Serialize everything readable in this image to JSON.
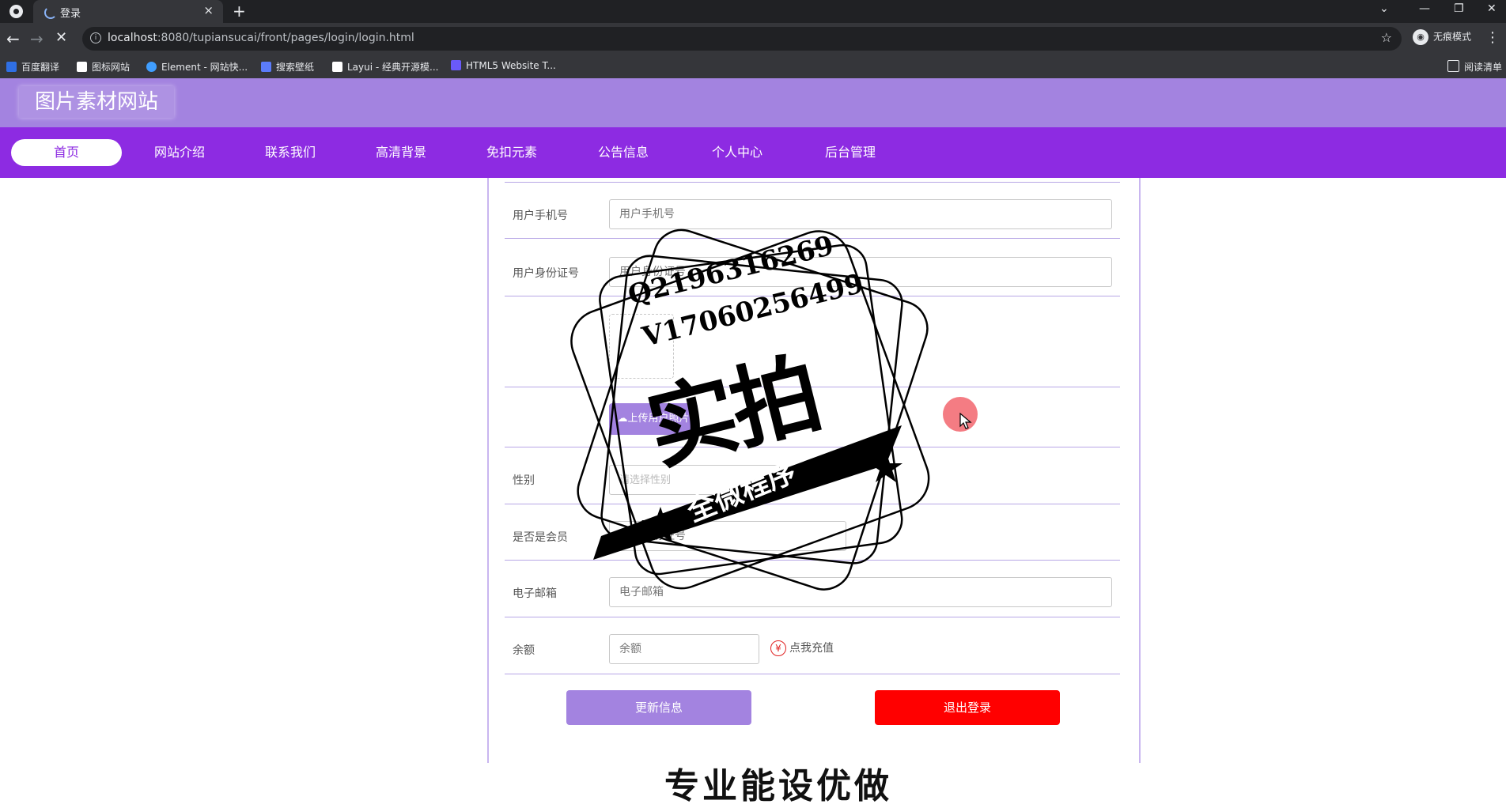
{
  "browser": {
    "tab_title": "登录",
    "tab_close": "×",
    "new_tab": "+",
    "url_host": "localhost",
    "url_path": ":8080/tupiansucai/front/pages/login/login.html",
    "incognito_label": "无痕模式",
    "reading_list": "阅读清单",
    "bookmarks": [
      {
        "label": "百度翻译",
        "color": "#2f6fe4"
      },
      {
        "label": "图标网站",
        "color": "#ffffff"
      },
      {
        "label": "Element - 网站快...",
        "color": "#409eff"
      },
      {
        "label": "搜索壁纸",
        "color": "#5b7cfa"
      },
      {
        "label": "Layui - 经典开源模...",
        "color": "#ffffff"
      },
      {
        "label": "HTML5 Website T...",
        "color": "#6a5af9"
      }
    ]
  },
  "site": {
    "logo": "图片素材网站",
    "nav": [
      "首页",
      "网站介绍",
      "联系我们",
      "高清背景",
      "免扣元素",
      "公告信息",
      "个人中心",
      "后台管理"
    ]
  },
  "form": {
    "phone_label": "用户手机号",
    "phone_placeholder": "用户手机号",
    "idcard_label": "用户身份证号",
    "idcard_placeholder": "用户身份证号",
    "upload_button": "上传用户照片",
    "gender_label": "性别",
    "gender_placeholder": "请选择性别",
    "member_label": "是否是会员",
    "member_placeholder": "用户身份证号",
    "email_label": "电子邮箱",
    "email_placeholder": "电子邮箱",
    "balance_label": "余额",
    "balance_placeholder": "余额",
    "recharge_icon": "¥",
    "recharge_link": "点我充值",
    "update_button": "更新信息",
    "logout_button": "退出登录"
  },
  "bottom_heading": "专业能设优做",
  "watermark": {
    "line1": "Q2196316269",
    "line2": "V17060256499",
    "big": "实拍",
    "ribbon": "全微程序"
  }
}
